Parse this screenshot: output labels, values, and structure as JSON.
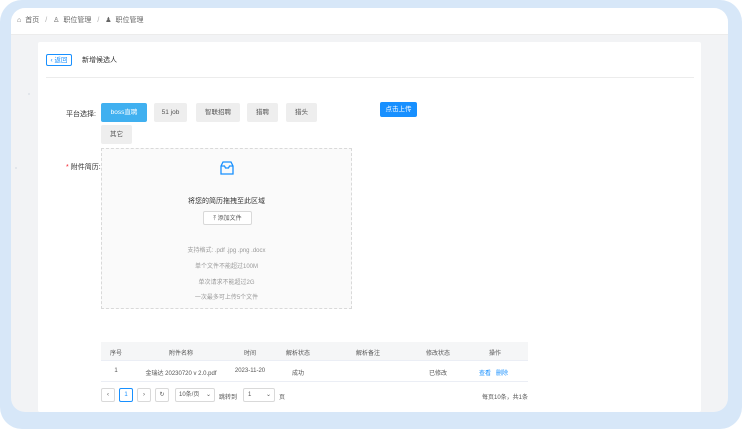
{
  "breadcrumb": [
    {
      "icon": "home-icon",
      "label": "首页"
    },
    {
      "icon": "user-icon",
      "label": "职位管理"
    },
    {
      "icon": "user-icon",
      "label": "职位管理"
    }
  ],
  "header": {
    "back_label": "返回",
    "title": "新增候选人"
  },
  "platform": {
    "label": "平台选择:",
    "options": [
      "boss直聘",
      "51 job",
      "智联招聘",
      "猎聘",
      "猎头",
      "其它"
    ],
    "selected": "boss直聘",
    "upload_button": "点击上传"
  },
  "attachment": {
    "label": "附件简历:",
    "required_mark": "*",
    "dropzone": {
      "icon": "folder-icon",
      "title": "将您的简历拖拽至此区域",
      "add_file": "添加文件",
      "add_icon": "upload-icon",
      "tips": [
        "支持格式: .pdf .jpg .png .docx",
        "单个文件不能超过100M",
        "单次请求不能超过2G",
        "一次最多可上传5个文件"
      ]
    }
  },
  "table": {
    "columns": [
      "序号",
      "附件名称",
      "时间",
      "解析状态",
      "解析备注",
      "修改状态",
      "操作"
    ],
    "rows": [
      {
        "index": "1",
        "name": "金瑞达 20230720 v 2.0.pdf",
        "time": "2023-11-20",
        "parse_status": "成功",
        "parse_note": "",
        "edit_status": "已修改",
        "view": "查看",
        "delete": "删除"
      }
    ]
  },
  "pagination": {
    "prev_icon": "chevron-left-icon",
    "current_page": "1",
    "next_icon": "chevron-right-icon",
    "refresh_icon": "refresh-icon",
    "page_size": "10条/页",
    "jump_label": "跳转到",
    "jump_value": "1",
    "page_unit": "页",
    "summary": "每页10条，共1条"
  }
}
